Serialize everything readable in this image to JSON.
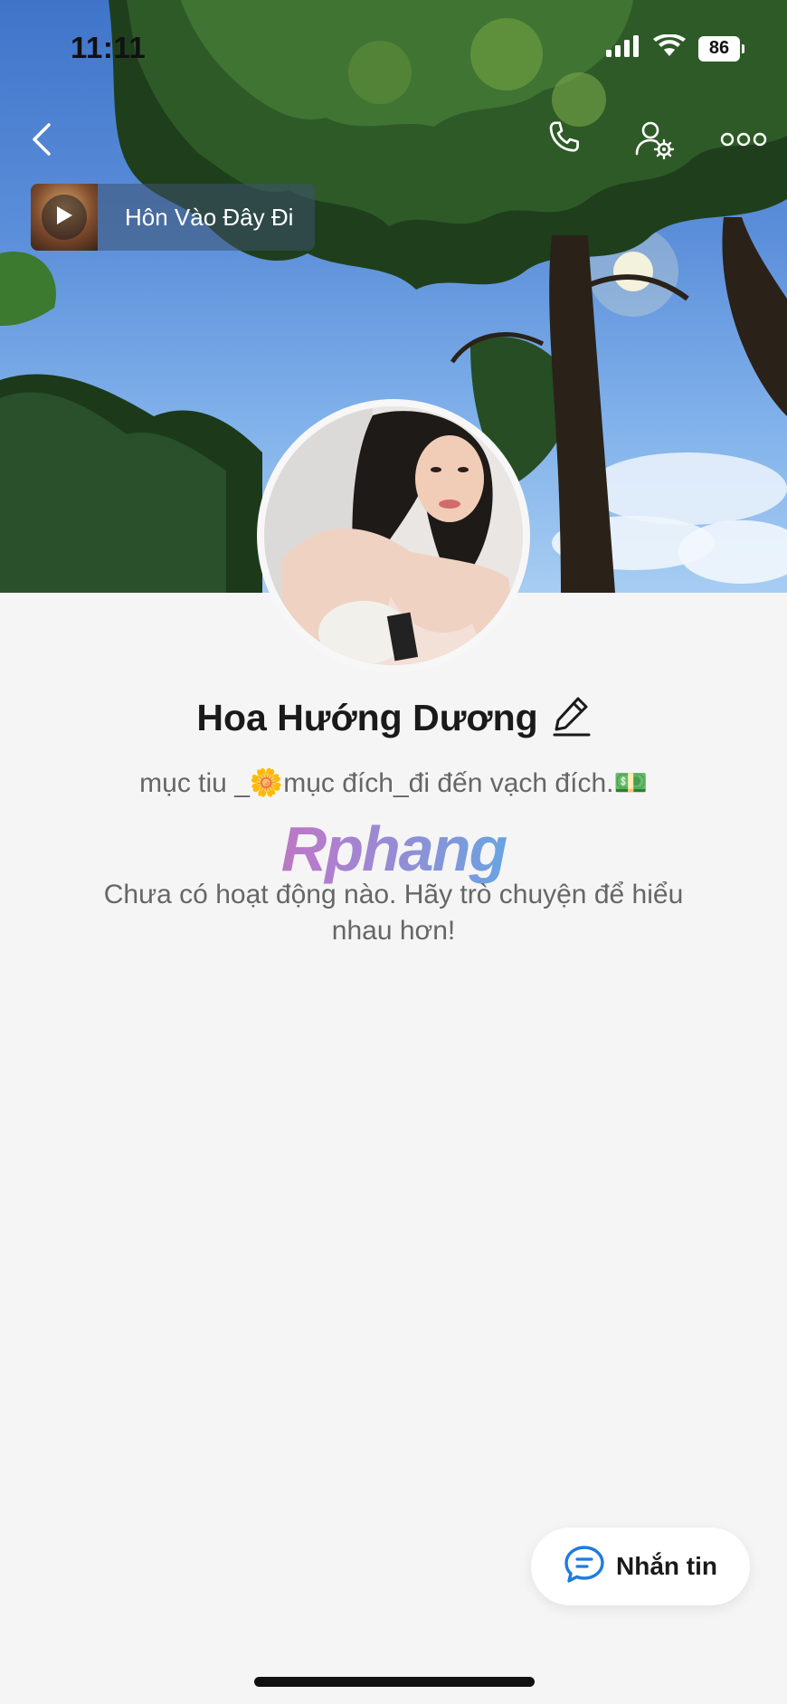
{
  "status_bar": {
    "time": "11:11",
    "battery": "86",
    "signal_icon": "cellular-signal-icon",
    "wifi_icon": "wifi-icon"
  },
  "nav": {
    "back_icon": "chevron-left-icon",
    "call_icon": "phone-icon",
    "settings_icon": "user-settings-icon",
    "more_icon": "more-horizontal-icon"
  },
  "music": {
    "title": "Hôn Vào Đây Đi",
    "play_icon": "play-icon"
  },
  "profile": {
    "name": "Hoa Hướng Dương",
    "edit_icon": "pencil-icon",
    "bio_part1": "mục tiu _",
    "bio_emoji1": "🌼",
    "bio_part2": "mục đích_đi đến vạch đích.",
    "bio_emoji2": "💵"
  },
  "watermark": "Rphang",
  "empty_message": "Chưa có hoạt động nào. Hãy trò chuyện để hiểu nhau hơn!",
  "message_button": {
    "label": "Nhắn tin",
    "icon": "chat-bubble-icon"
  },
  "colors": {
    "accent": "#1f7ae0",
    "background": "#f5f5f5",
    "text_primary": "#1a1a1a",
    "text_secondary": "#666666"
  }
}
